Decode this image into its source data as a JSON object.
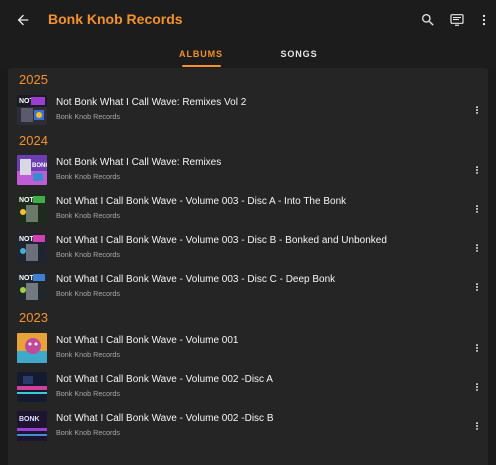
{
  "header": {
    "title": "Bonk Knob Records",
    "back_icon": "arrow-left-icon",
    "actions": [
      "search-icon",
      "cast-icon",
      "more-vertical-icon"
    ],
    "accent_color": "#f3922a"
  },
  "tabs": [
    {
      "label": "ALBUMS",
      "selected": true
    },
    {
      "label": "SONGS",
      "selected": false
    }
  ],
  "years": [
    {
      "year": "2025"
    },
    {
      "year": "2024"
    },
    {
      "year": "2023"
    }
  ],
  "albums": [
    {
      "title": "Not Bonk What I Call Wave: Remixes Vol 2",
      "artist": "Bonk Knob Records",
      "year": "2025"
    },
    {
      "title": "Not Bonk What I Call Wave: Remixes",
      "artist": "Bonk Knob Records",
      "year": "2024"
    },
    {
      "title": "Not What I Call Bonk Wave - Volume 003 - Disc A - Into The Bonk",
      "artist": "Bonk Knob Records",
      "year": "2024"
    },
    {
      "title": "Not What I Call Bonk Wave - Volume 003 - Disc B - Bonked and Unbonked",
      "artist": "Bonk Knob Records",
      "year": "2024"
    },
    {
      "title": "Not What I Call Bonk Wave - Volume 003 - Disc C - Deep Bonk",
      "artist": "Bonk Knob Records",
      "year": "2024"
    },
    {
      "title": "Not What I Call Bonk Wave - Volume 001",
      "artist": "Bonk Knob Records",
      "year": "2023"
    },
    {
      "title": "Not What I Call Bonk Wave - Volume 002 -Disc A",
      "artist": "Bonk Knob Records",
      "year": "2023"
    },
    {
      "title": "Not What I Call Bonk Wave - Volume 002 -Disc B",
      "artist": "Bonk Knob Records",
      "year": "2023"
    }
  ]
}
